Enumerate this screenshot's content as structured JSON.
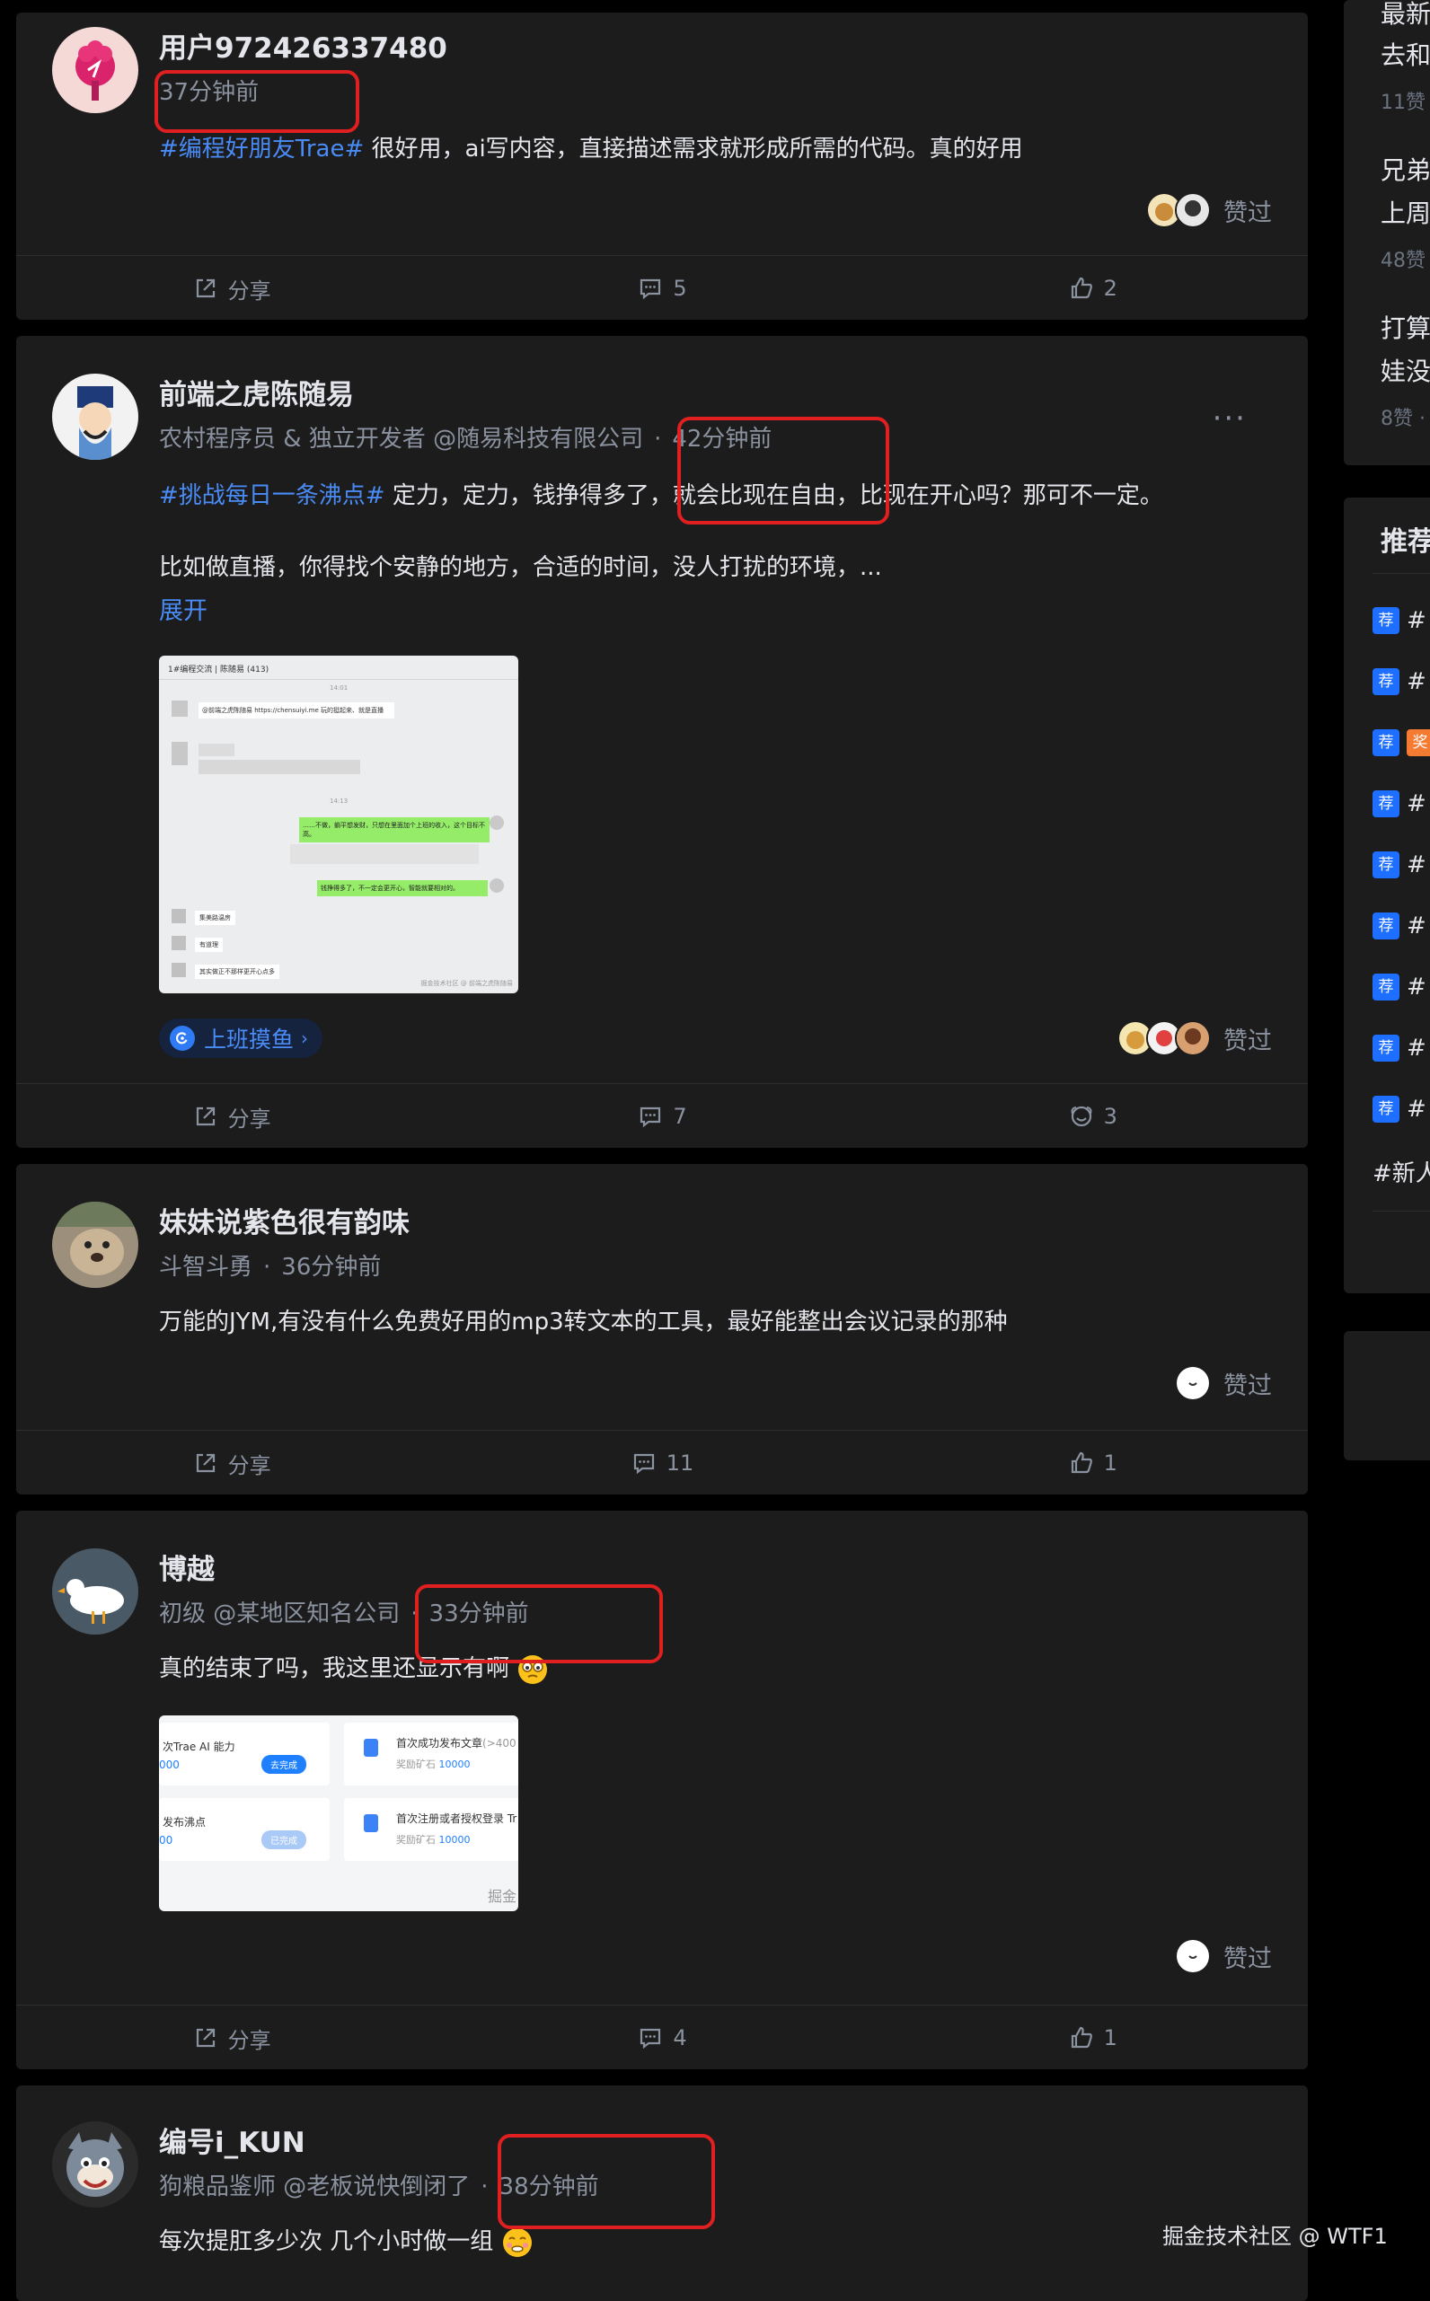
{
  "posts": [
    {
      "username": "用户972426337480",
      "meta_prefix": "",
      "time": "37分钟前",
      "tag": "#编程好朋友Trae#",
      "text": " 很好用，ai写内容，直接描述需求就形成所需的代码。真的好用",
      "likers_label": "赞过",
      "share_label": "分享",
      "comments": "5",
      "likes": "2"
    },
    {
      "username": "前端之虎陈随易",
      "meta_prefix": "农村程序员 & 独立开发者 @随易科技有限公司",
      "time": "42分钟前",
      "tag": "#挑战每日一条沸点#",
      "text": " 定力，定力，钱挣得多了，就会比现在自由，比现在开心吗？那可不一定。",
      "text2": "比如做直播，你得找个安静的地方，合适的时间，没人打扰的环境，...",
      "expand": "展开",
      "circle": "上班摸鱼",
      "likers_label": "赞过",
      "share_label": "分享",
      "comments": "7",
      "likes": "3",
      "image": {
        "title": "1#编程交流 | 陈随易 (413)",
        "time1": "14:01",
        "time2": "14:13",
        "msg1": "@前端之虎陈随易 https://chensuiyi.me 玩的挺起来、就是直播",
        "msg_right1": "……不做，躺平想发财，只想在里面加个上班的收入，这个目标不高。",
        "msg_right2": "钱挣得多了，不一定会更开心，智能就要相对的。",
        "msg_left1": "集美路温房",
        "msg_left2": "有道理",
        "msg_left3": "其实做正不那样更开心点多",
        "footer": "掘金技术社区 @ 前端之虎陈随易"
      }
    },
    {
      "username": "妹妹说紫色很有韵味",
      "meta_prefix": "斗智斗勇",
      "time": "36分钟前",
      "tag": "",
      "text": "万能的JYM,有没有什么免费好用的mp3转文本的工具，最好能整出会议记录的那种",
      "likers_label": "赞过",
      "share_label": "分享",
      "comments": "11",
      "likes": "1"
    },
    {
      "username": "博越",
      "meta_prefix": "初级 @某地区知名公司",
      "time": "33分钟前",
      "tag": "",
      "text": "真的结束了吗，我这里还显示有啊",
      "likers_label": "赞过",
      "share_label": "分享",
      "comments": "4",
      "likes": "1",
      "image": {
        "task1": "次Trae AI 能力",
        "task1_reward": "000",
        "task1_btn": "去完成",
        "task2": "首次成功发布文章",
        "task2_extra": "(>400",
        "task2_reward_label": "奖励矿石",
        "task2_reward": "10000",
        "task3": "发布沸点",
        "task3_reward": "00",
        "task3_btn": "已完成",
        "task4": "首次注册或者授权登录 Tr",
        "task4_reward_label": "奖励矿石",
        "task4_reward": "10000",
        "footer": "掘金"
      }
    },
    {
      "username": "编号i_KUN",
      "meta_prefix": "狗粮品鉴师 @老板说快倒闭了",
      "time": "38分钟前",
      "tag": "",
      "text": "每次提肛多少次 几个小时做一组"
    }
  ],
  "sidebar": {
    "top_items": [
      {
        "line1": "最新",
        "line2": "去和",
        "stat": "11赞"
      },
      {
        "line1": "兄弟",
        "line2": "上周",
        "stat": "48赞"
      },
      {
        "line1": "打算",
        "line2": "娃没",
        "stat": "8赞 ·"
      }
    ],
    "recommend_title": "推荐",
    "recommend_badges": [
      "荐",
      "荐",
      "荐",
      "荐",
      "荐",
      "荐",
      "荐",
      "荐",
      "荐"
    ],
    "recommend_orange": "奖",
    "recommend_hash": [
      "#",
      "#",
      "#",
      "#",
      "#",
      "#",
      "#",
      "#",
      "#"
    ],
    "recommend_after": [
      "",
      "",
      "",
      "",
      "",
      "",
      "",
      "",
      ""
    ],
    "new_user": "#新人"
  },
  "watermark": "掘金技术社区 @ WTF1",
  "colors": {
    "page_bg": "#000000",
    "card_bg": "#1c1c1c",
    "accent": "#4a8cf7",
    "highlight": "#e02020"
  }
}
